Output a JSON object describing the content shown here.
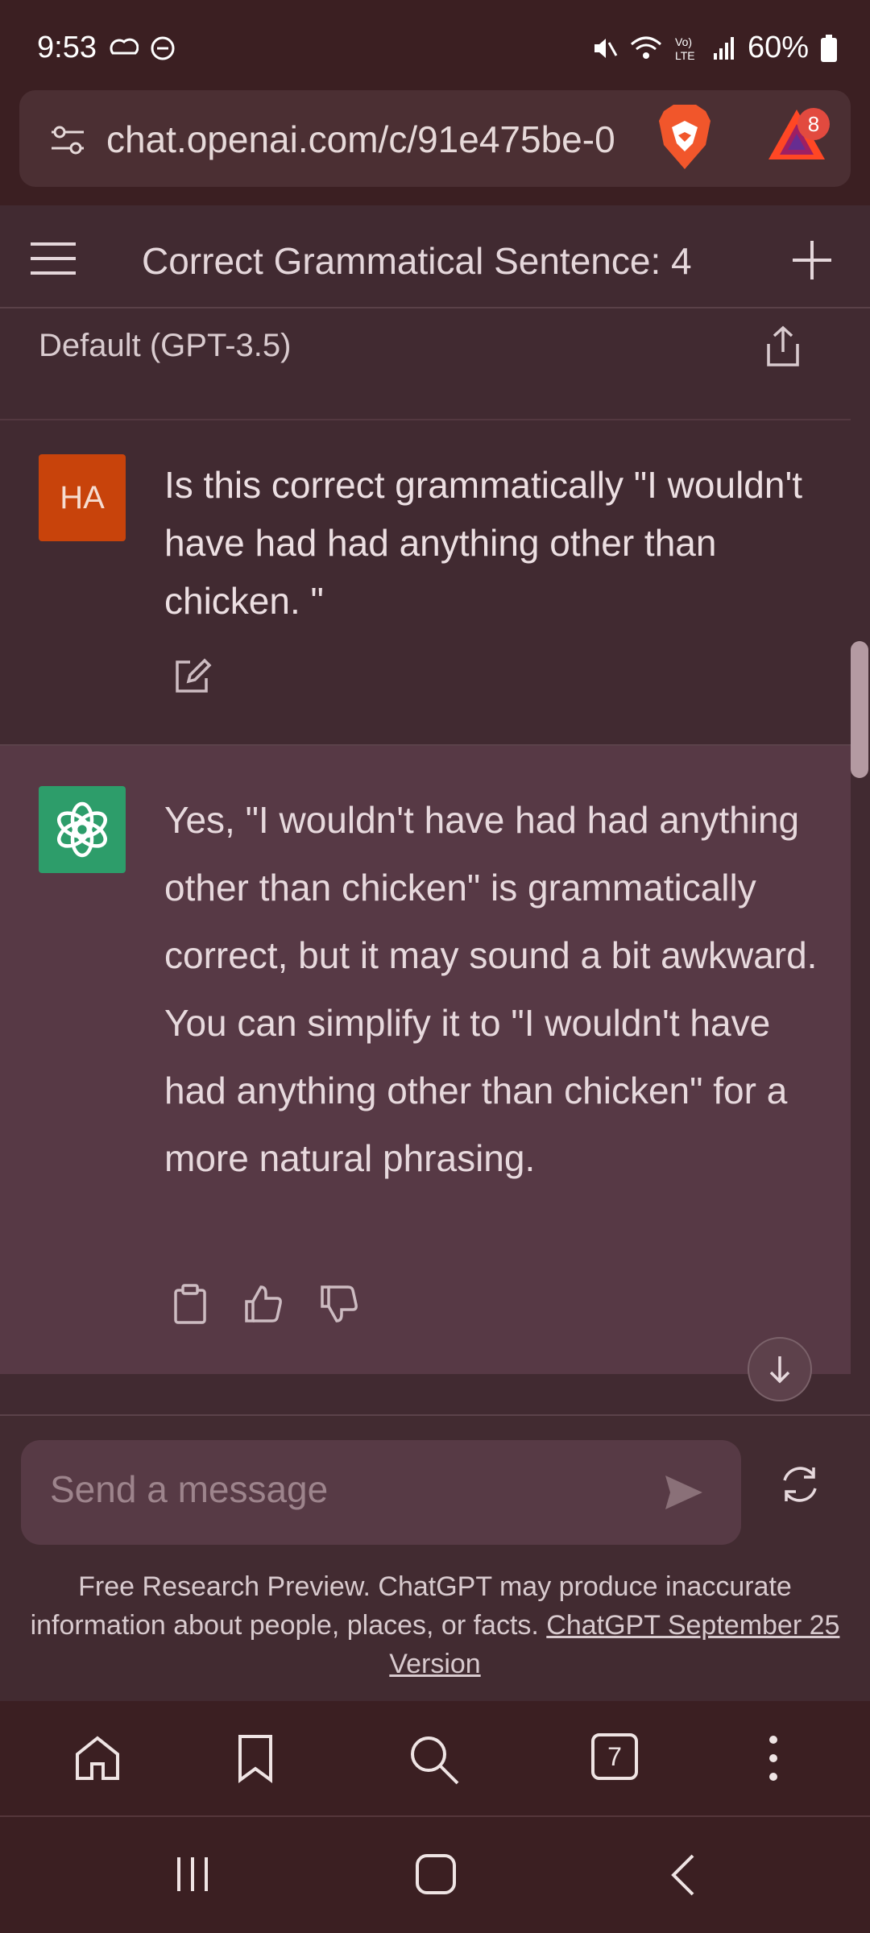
{
  "status_bar": {
    "time": "9:53",
    "battery": "60%"
  },
  "browser": {
    "url": "chat.openai.com/c/91e475be-0",
    "rewards_badge": "8",
    "tab_count": "7"
  },
  "chat": {
    "title": "Correct Grammatical Sentence: 4",
    "model": "Default (GPT-3.5)",
    "user_initials": "HA",
    "user_message": "Is this correct grammatically \"I wouldn't have had had anything other than chicken. \"",
    "assistant_message": "Yes, \"I wouldn't have had had anything other than chicken\" is grammatically correct, but it may sound a bit awkward. You can simplify it to \"I wouldn't have had anything other than chicken\" for a more natural phrasing."
  },
  "composer": {
    "placeholder": "Send a message"
  },
  "disclaimer": {
    "text": "Free Research Preview. ChatGPT may produce inaccurate information about people, places, or facts. ",
    "link": "ChatGPT September 25 Version"
  },
  "colors": {
    "user_avatar": "#c8430b",
    "assistant_avatar": "#2d9d6a",
    "assistant_bg": "#573945",
    "page_bg": "#412a31"
  },
  "icons": [
    "tune-icon",
    "brave-lion-icon",
    "bat-rewards-icon",
    "menu-icon",
    "plus-icon",
    "share-icon",
    "edit-icon",
    "openai-logo-icon",
    "copy-icon",
    "thumbs-up-icon",
    "thumbs-down-icon",
    "arrow-down-icon",
    "send-icon",
    "refresh-icon",
    "home-icon",
    "bookmark-icon",
    "search-icon",
    "more-icon",
    "recents-icon",
    "home-nav-icon",
    "back-icon"
  ]
}
